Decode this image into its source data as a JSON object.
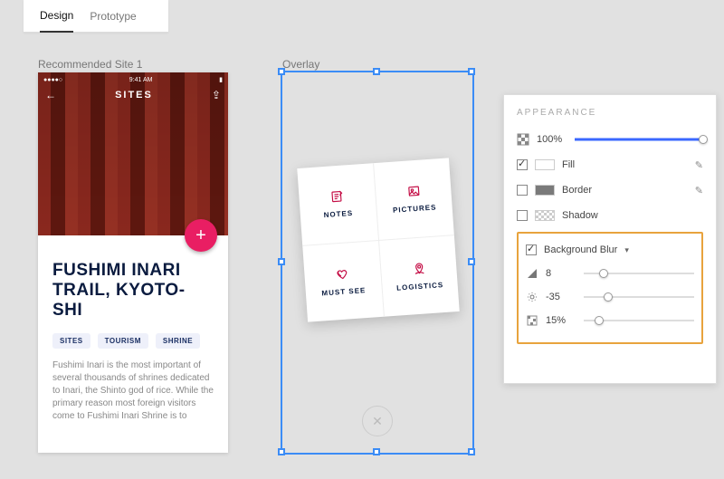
{
  "tabs": {
    "design": "Design",
    "prototype": "Prototype",
    "active": "design"
  },
  "artboards": {
    "recommended": {
      "label": "Recommended Site 1",
      "status_time": "9:41 AM",
      "nav_title": "SITES",
      "title": "FUSHIMI INARI TRAIL, KYOTO-SHI",
      "chips": [
        "SITES",
        "TOURISM",
        "SHRINE"
      ],
      "paragraph": "Fushimi Inari is the most important of several thousands of shrines dedicated to Inari, the Shinto god of rice. While the primary reason most foreign visitors come to Fushimi Inari Shrine is to"
    },
    "overlay": {
      "label": "Overlay",
      "cells": [
        {
          "label": "NOTES"
        },
        {
          "label": "PICTURES"
        },
        {
          "label": "MUST SEE"
        },
        {
          "label": "LOGISTICS"
        }
      ]
    }
  },
  "panel": {
    "title": "APPEARANCE",
    "opacity": {
      "value": "100%",
      "fill_pct": 100
    },
    "fill": {
      "checked": true,
      "label": "Fill"
    },
    "border": {
      "checked": false,
      "label": "Border"
    },
    "shadow": {
      "checked": false,
      "label": "Shadow"
    },
    "bgblur": {
      "checked": true,
      "label": "Background Blur",
      "amount": {
        "value": "8",
        "fill_pct": 18
      },
      "brightness": {
        "value": "-35",
        "fill_pct": 22
      },
      "noise": {
        "value": "15%",
        "fill_pct": 14
      }
    }
  }
}
